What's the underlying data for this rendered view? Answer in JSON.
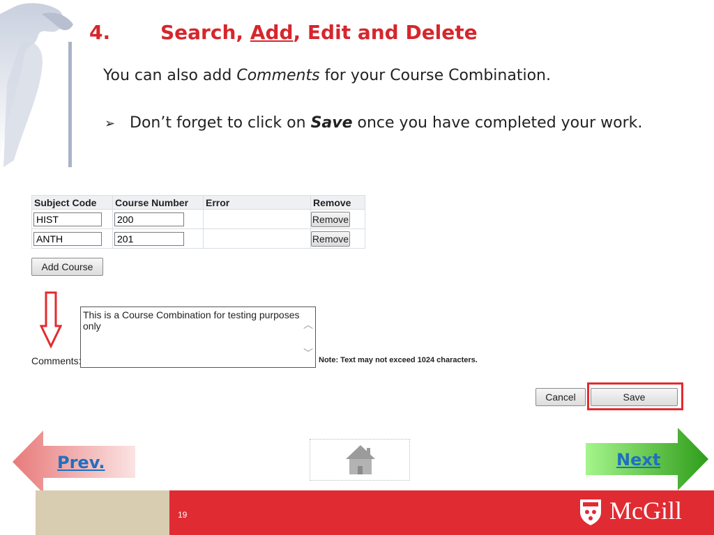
{
  "slide": {
    "number": "4.",
    "title_before": "Search, ",
    "title_underlined": "Add",
    "title_after": ", Edit and Delete",
    "line1_before": "You can also add ",
    "line1_italic": "Comments",
    "line1_after": " for your Course Combination.",
    "line2_bullet": "➢",
    "line2_before": "Don’t forget to click on ",
    "line2_bold": "Save",
    "line2_after": " once you have completed your work."
  },
  "form": {
    "headers": [
      "Subject Code",
      "Course Number",
      "Error",
      "Remove"
    ],
    "rows": [
      {
        "subject": "HIST",
        "number": "200",
        "error": "",
        "remove_label": "Remove"
      },
      {
        "subject": "ANTH",
        "number": "201",
        "error": "",
        "remove_label": "Remove"
      }
    ],
    "add_course_label": "Add Course",
    "comments_label": "Comments:",
    "comments_text": "This is a Course Combination for testing purposes only",
    "note": "Note: Text may not exceed 1024 characters.",
    "cancel_label": "Cancel",
    "save_label": "Save"
  },
  "nav": {
    "prev_label": "Prev.",
    "next_label": "Next",
    "home_icon": "home-icon"
  },
  "footer": {
    "page_number": "19",
    "logo_text": "McGill"
  },
  "colors": {
    "title_red": "#d6262c",
    "footer_red": "#e12b33",
    "footer_beige": "#d8cdb0",
    "link_blue": "#1f6fbf",
    "highlight_red": "#e32a2f"
  }
}
